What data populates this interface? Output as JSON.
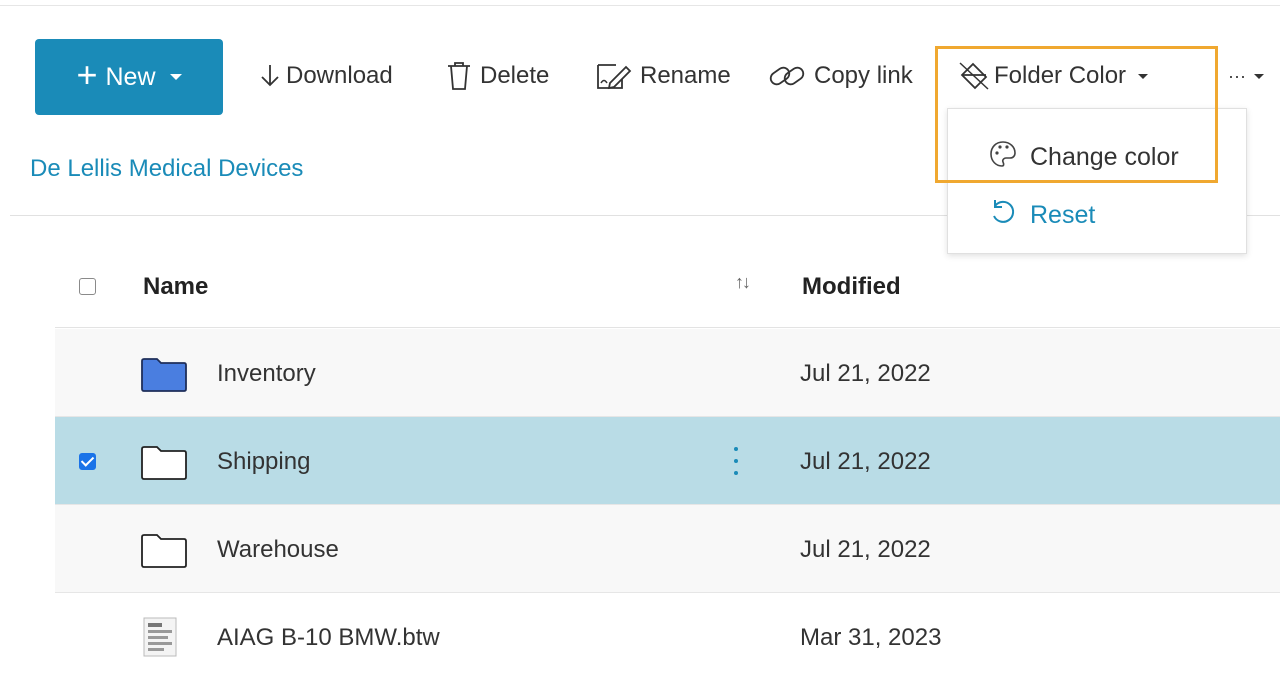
{
  "toolbar": {
    "new_label": "New",
    "download_label": "Download",
    "delete_label": "Delete",
    "rename_label": "Rename",
    "copy_link_label": "Copy link",
    "folder_color_label": "Folder Color",
    "more_label": "···"
  },
  "folder_color_menu": {
    "change_color_label": "Change color",
    "reset_label": "Reset"
  },
  "breadcrumb": {
    "current": "De Lellis Medical Devices"
  },
  "list": {
    "columns": {
      "name": "Name",
      "sort": "↑↓",
      "modified": "Modified"
    },
    "rows": [
      {
        "name": "Inventory",
        "modified": "Jul 21, 2022",
        "type": "folder",
        "folder_color": "#4a7ee0",
        "selected": false
      },
      {
        "name": "Shipping",
        "modified": "Jul 21, 2022",
        "type": "folder",
        "folder_color": "none",
        "selected": true
      },
      {
        "name": "Warehouse",
        "modified": "Jul 21, 2022",
        "type": "folder",
        "folder_color": "none",
        "selected": false
      },
      {
        "name": "AIAG B-10 BMW.btw",
        "modified": "Mar 31, 2023",
        "type": "file",
        "selected": false
      }
    ]
  },
  "colors": {
    "accent": "#1a8bb8",
    "highlight_border": "#f0a830",
    "selected_row": "#b9dce6",
    "checkbox_checked": "#1a73e8"
  }
}
